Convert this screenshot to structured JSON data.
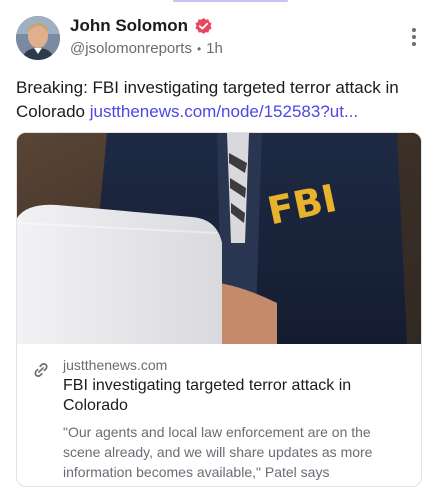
{
  "author": {
    "display_name": "John Solomon",
    "handle": "@jsolomonreports",
    "separator": "•",
    "time": "1h",
    "verified_color": "#e8455f",
    "avatar_icon": "profile-photo"
  },
  "post": {
    "text": "Breaking: FBI investigating targeted terror attack in Colorado ",
    "link_text": "justthenews.com/node/152583?ut..."
  },
  "card": {
    "image_icon": "fbi-jacket-laptop-photo",
    "jacket_text": "FBI",
    "domain": "justthenews.com",
    "title": "FBI investigating targeted terror attack in Colorado",
    "description": "\"Our agents and local law enforcement are on the scene already, and we will share updates as more information becomes available,\" Patel says"
  },
  "colors": {
    "link": "#4f46e5",
    "muted": "#6b6b75",
    "accent_bar": "#c9c2f5"
  }
}
